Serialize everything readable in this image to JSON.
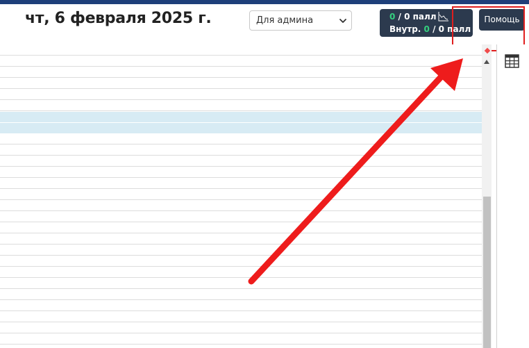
{
  "header": {
    "date_title": "чт, 6 февраля 2025 г.",
    "role_select_value": "Для админа",
    "help_label": "Помощь"
  },
  "pallets": {
    "line1_count": "0",
    "line1_rest": " / 0 палл",
    "line2_prefix": "Внутр. ",
    "line2_count": "0",
    "line2_rest": " / 0 палл"
  },
  "icons": {
    "chart": "chart-line-icon",
    "select_arrow": "chevron-down-icon",
    "table": "table-grid-icon",
    "scroll_up": "triangle-up-icon"
  },
  "colors": {
    "header_bar": "#1e3f7a",
    "button_bg": "#2c3a4e",
    "green_count": "#35d07f",
    "highlight_red": "#e01e1e",
    "row_highlight": "#d7ebf4"
  }
}
